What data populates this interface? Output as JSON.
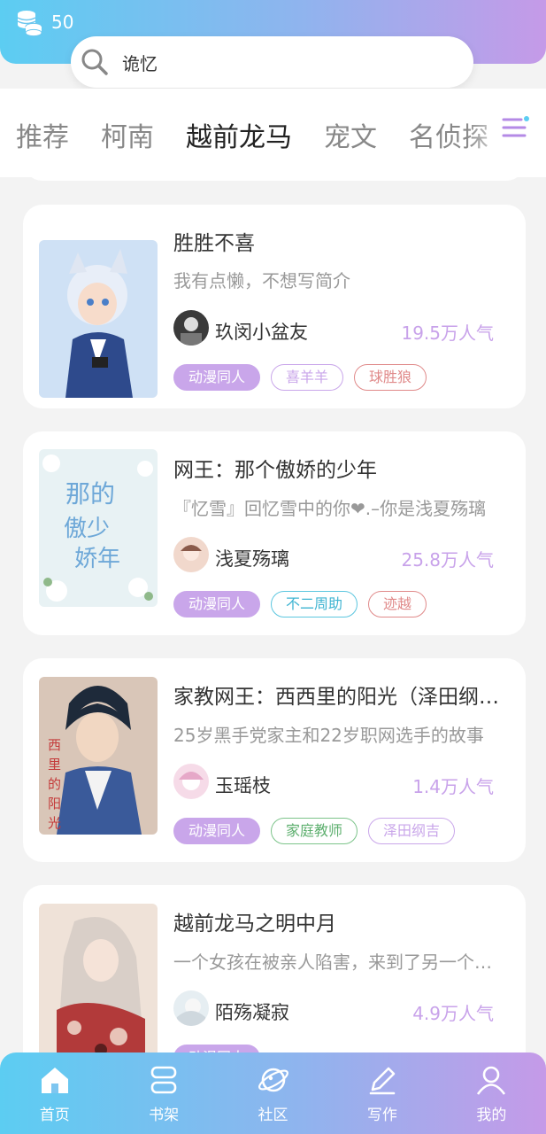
{
  "header": {
    "coins": "50"
  },
  "search": {
    "value": "诡忆"
  },
  "tabs": [
    {
      "label": "推荐",
      "active": false
    },
    {
      "label": "柯南",
      "active": false
    },
    {
      "label": "越前龙马",
      "active": true
    },
    {
      "label": "宠文",
      "active": false
    },
    {
      "label": "名侦探",
      "active": false
    }
  ],
  "books": [
    {
      "title": "胜胜不喜",
      "desc": "我有点懒，不想写简介",
      "author": "玖闵小盆友",
      "popularity": "19.5万人气",
      "tags": [
        {
          "label": "动漫同人",
          "style": "filled",
          "color": "#c9a6ea"
        },
        {
          "label": "喜羊羊",
          "style": "outline",
          "color": "#c9a6ea"
        },
        {
          "label": "球胜狼",
          "style": "outline",
          "color": "#e08a8a"
        }
      ]
    },
    {
      "title": "网王：那个傲娇的少年",
      "desc": "『忆雪』回忆雪中的你❤.–你是浅夏殇璃",
      "author": "浅夏殇璃",
      "popularity": "25.8万人气",
      "tags": [
        {
          "label": "动漫同人",
          "style": "filled",
          "color": "#c9a6ea"
        },
        {
          "label": "不二周助",
          "style": "outline",
          "color": "#5cc6df"
        },
        {
          "label": "迹越",
          "style": "outline",
          "color": "#e08a8a"
        }
      ]
    },
    {
      "title": "家教网王：西西里的阳光（泽田纲吉）",
      "desc": "25岁黑手党家主和22岁职网选手的故事",
      "author": "玉瑶枝",
      "popularity": "1.4万人气",
      "tags": [
        {
          "label": "动漫同人",
          "style": "filled",
          "color": "#c9a6ea"
        },
        {
          "label": "家庭教师",
          "style": "outline",
          "color": "#7cc48a"
        },
        {
          "label": "泽田纲吉",
          "style": "outline",
          "color": "#c9a6ea"
        }
      ]
    },
    {
      "title": "越前龙马之明中月",
      "desc": "一个女孩在被亲人陷害，来到了另一个世界",
      "author": "陌殇凝寂",
      "popularity": "4.9万人气",
      "tags": [
        {
          "label": "动漫同人",
          "style": "filled",
          "color": "#c9a6ea"
        }
      ]
    }
  ],
  "nav": [
    {
      "label": "首页",
      "icon": "home-icon"
    },
    {
      "label": "书架",
      "icon": "bookshelf-icon"
    },
    {
      "label": "社区",
      "icon": "planet-icon"
    },
    {
      "label": "写作",
      "icon": "pen-icon"
    },
    {
      "label": "我的",
      "icon": "user-icon"
    }
  ]
}
